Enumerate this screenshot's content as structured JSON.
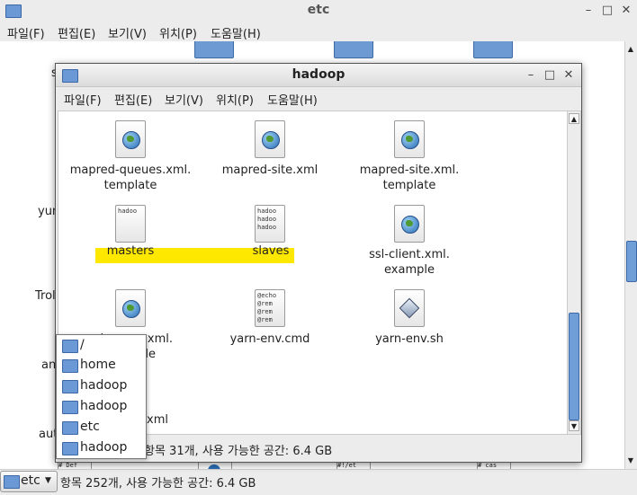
{
  "background_window": {
    "title": "etc",
    "controls": [
      "–",
      "□",
      "✕"
    ],
    "menu": [
      "파일(F)",
      "편집(E)",
      "보기(V)",
      "위치(P)",
      "도움말(H)"
    ],
    "partial_labels": [
      "yum",
      "Trol",
      "an",
      "aut"
    ],
    "status": "항목 252개, 사용 가능한 공간: 6.4 GB",
    "path_button": "etc"
  },
  "foreground_window": {
    "title": "hadoop",
    "controls": [
      "–",
      "□",
      "✕"
    ],
    "menu": [
      "파일(F)",
      "편집(E)",
      "보기(V)",
      "위치(P)",
      "도움말(H)"
    ],
    "files": [
      {
        "name": "mapred-queues.xml.\ntemplate",
        "icon": "globe-doc-icon"
      },
      {
        "name": "mapred-site.xml",
        "icon": "globe-doc-icon"
      },
      {
        "name": "mapred-site.xml.\ntemplate",
        "icon": "globe-doc-icon"
      },
      {
        "name": "masters",
        "icon": "text-doc-icon",
        "preview": "hadoo"
      },
      {
        "name": "slaves",
        "icon": "text-doc-icon",
        "preview": "hadoo\nhadoo\nhadoo"
      },
      {
        "name": "ssl-client.xml.\nexample",
        "icon": "globe-doc-icon"
      },
      {
        "name": "ssl-server.xml.\nexample",
        "icon": "globe-doc-icon"
      },
      {
        "name": "yarn-env.cmd",
        "icon": "script-doc-icon",
        "preview": "@echo\n@rem\n@rem\n@rem"
      },
      {
        "name": "yarn-env.sh",
        "icon": "shell-script-icon"
      }
    ],
    "partial_label": "xml",
    "status": "항목 31개, 사용 가능한 공간: 6.4 GB",
    "highlight_color": "#ffe800"
  },
  "path_dropdown": {
    "items": [
      "/",
      "home",
      "hadoop",
      "hadoop",
      "etc",
      "hadoop"
    ]
  },
  "bottom_previews": [
    "# Def",
    "#!/et",
    "# cas\n#"
  ]
}
